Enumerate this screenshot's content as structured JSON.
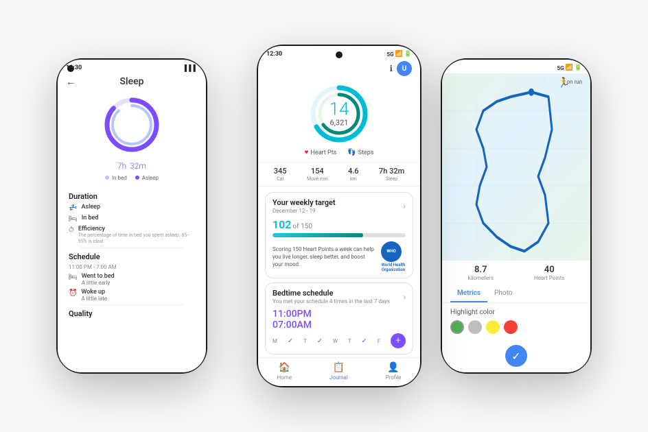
{
  "phones": {
    "left": {
      "time": "12:30",
      "title": "Sleep",
      "sleep_time": "7h",
      "sleep_min": "32m",
      "legend": {
        "in_bed": "In bed",
        "asleep": "Asleep"
      },
      "sections": {
        "duration": {
          "title": "Duration",
          "asleep_label": "Asleep",
          "in_bed_label": "In bed",
          "efficiency_label": "Efficiency",
          "efficiency_desc": "The percentage of time in bed you spent asleep. 85–95% is ideal"
        },
        "schedule": {
          "title": "Schedule",
          "time_range": "11:00 PM - 7:00 AM",
          "went_to_bed_label": "Went to bed",
          "went_to_bed_value": "A little early",
          "woke_up_label": "Woke up",
          "woke_up_value": "A little late"
        },
        "quality": {
          "title": "Quality"
        }
      }
    },
    "center": {
      "time": "12:30",
      "ring_main": "14",
      "ring_sub": "6,321",
      "heart_pts_label": "Heart Pts",
      "steps_label": "Steps",
      "stats": [
        {
          "value": "345",
          "label": "Cal"
        },
        {
          "value": "154",
          "label": "Move min"
        },
        {
          "value": "4.6",
          "label": "km"
        },
        {
          "value": "7h 32m",
          "label": "Sleep"
        }
      ],
      "weekly_target": {
        "title": "Your weekly target",
        "date_range": "December 12 - 19",
        "progress_current": "102",
        "progress_of": "of 150",
        "progress_percent": 68,
        "who_text": "Scoring 150 Heart Points a week can help you live longer, sleep better, and boost your mood.",
        "who_name": "World Health\nOrganization"
      },
      "bedtime": {
        "title": "Bedtime schedule",
        "subtitle": "You met your schedule 4 times in the last 7 days",
        "pm_time": "11:00PM",
        "am_time": "07:00AM",
        "days": [
          "M",
          "T",
          "W",
          "T",
          "F"
        ],
        "checks": [
          true,
          true,
          false,
          true,
          true
        ]
      },
      "nav": [
        {
          "label": "Home",
          "icon": "🏠",
          "active": false
        },
        {
          "label": "Journal",
          "icon": "📋",
          "active": true
        },
        {
          "label": "Profile",
          "icon": "👤",
          "active": false
        }
      ]
    },
    "right": {
      "time": "5G",
      "map_label": "on run",
      "km_value": "8.7",
      "km_label": "kilometers",
      "hp_value": "40",
      "hp_label": "Heart Points",
      "tabs": [
        "Metrics",
        "Photo"
      ],
      "active_tab": "Metrics",
      "highlight_label": "Highlight color",
      "colors": [
        "#4caf50",
        "#bdbdbd",
        "#ffeb3b",
        "#f44336"
      ],
      "active_color_index": 0
    }
  }
}
